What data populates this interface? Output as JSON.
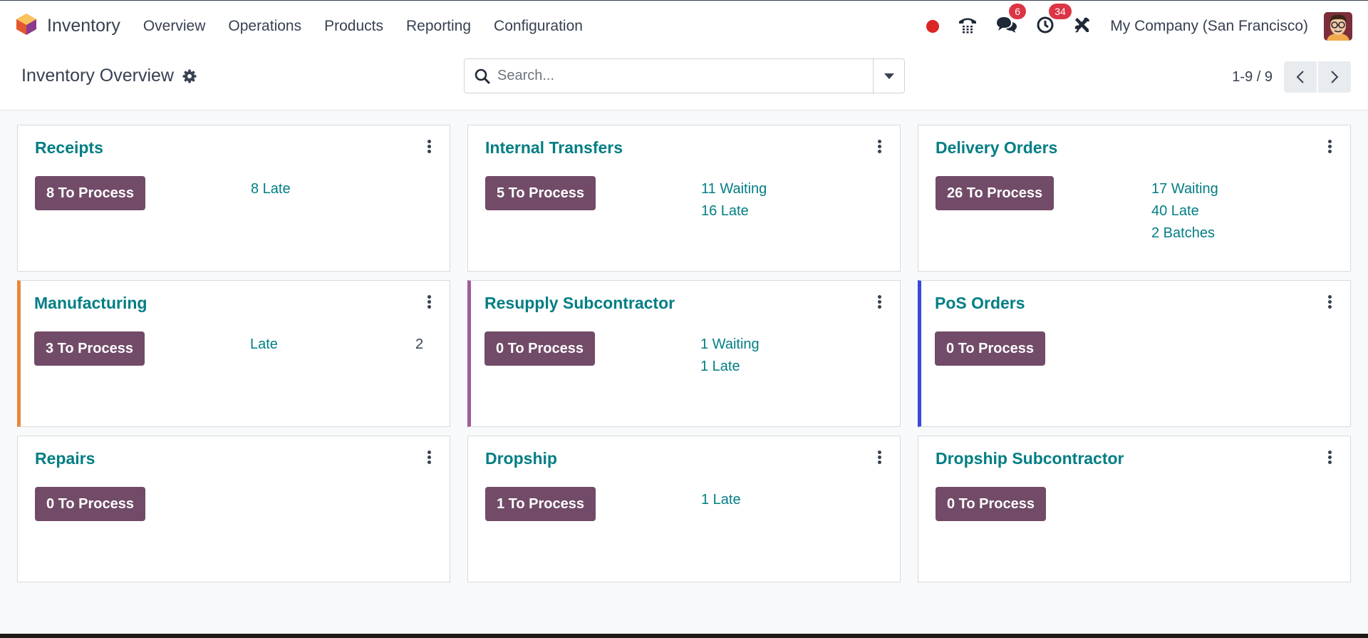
{
  "navbar": {
    "app_name": "Inventory",
    "menu": [
      "Overview",
      "Operations",
      "Products",
      "Reporting",
      "Configuration"
    ],
    "messages_badge": "6",
    "activities_badge": "34",
    "company": "My Company (San Francisco)"
  },
  "control_panel": {
    "title": "Inventory Overview",
    "search_placeholder": "Search...",
    "pager": "1-9 / 9"
  },
  "cards": [
    {
      "title": "Receipts",
      "button": "8 To Process",
      "stats": [
        "8 Late"
      ]
    },
    {
      "title": "Internal Transfers",
      "button": "5 To Process",
      "stats": [
        "11 Waiting",
        "16 Late"
      ]
    },
    {
      "title": "Delivery Orders",
      "button": "26 To Process",
      "stats": [
        "17 Waiting",
        "40 Late",
        "2 Batches"
      ]
    },
    {
      "title": "Manufacturing",
      "button": "3 To Process",
      "stats": [
        "Late"
      ],
      "count": "2"
    },
    {
      "title": "Resupply Subcontractor",
      "button": "0 To Process",
      "stats": [
        "1 Waiting",
        "1 Late"
      ]
    },
    {
      "title": "PoS Orders",
      "button": "0 To Process",
      "stats": []
    },
    {
      "title": "Repairs",
      "button": "0 To Process",
      "stats": []
    },
    {
      "title": "Dropship",
      "button": "1 To Process",
      "stats": [
        "1 Late"
      ]
    },
    {
      "title": "Dropship Subcontractor",
      "button": "0 To Process",
      "stats": []
    }
  ],
  "colors": {
    "brand_purple": "#714b67",
    "link_teal": "#017e84",
    "badge_red": "#dc3545",
    "card_orange": "#e8883b",
    "card_purple": "#a45c9c",
    "card_blue": "#3a49d9"
  }
}
